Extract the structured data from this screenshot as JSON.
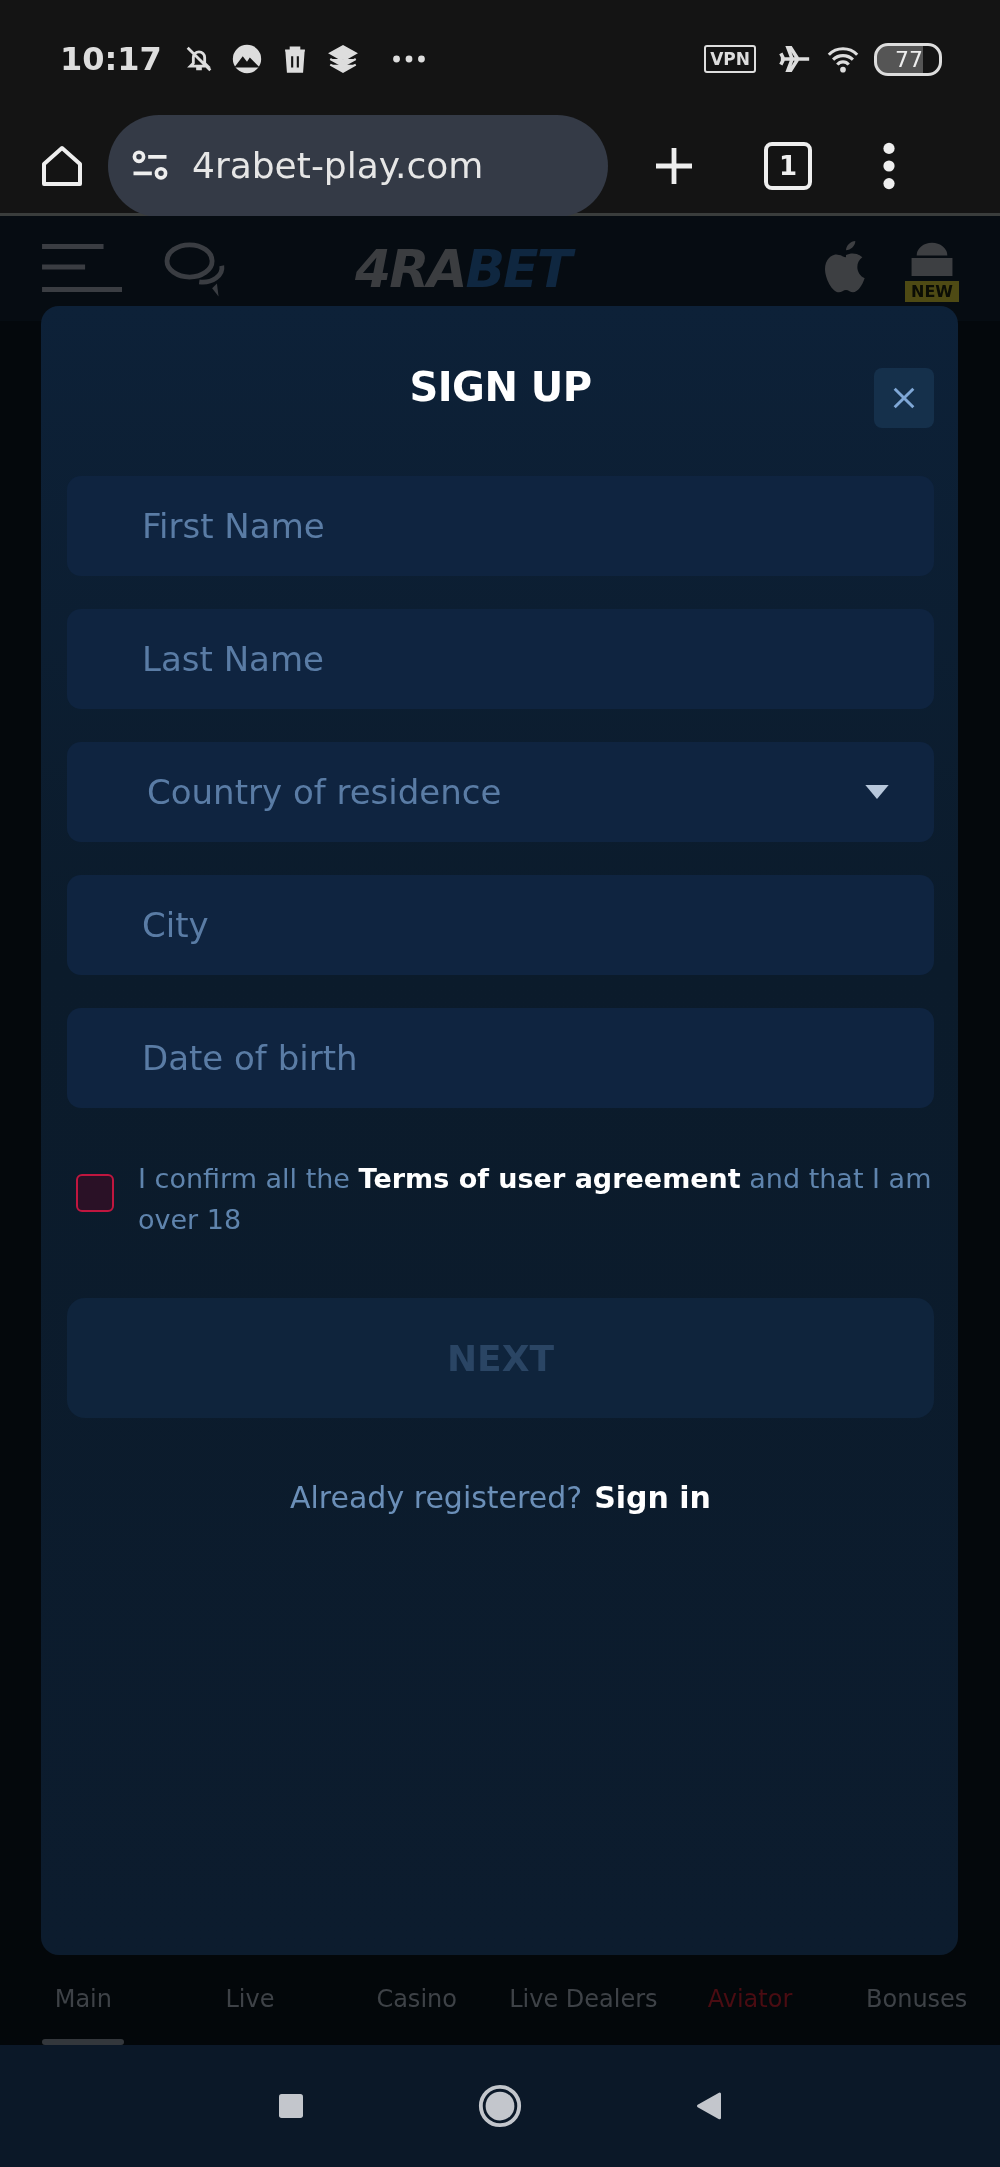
{
  "status_bar": {
    "time": "10:17",
    "vpn": "VPN",
    "battery": "77"
  },
  "browser": {
    "url": "4rabet-play.com",
    "tab_count": "1"
  },
  "site_header": {
    "logo_parts": [
      "4RA",
      "BET"
    ],
    "android_badge": "NEW"
  },
  "modal": {
    "title": "SIGN UP",
    "fields": [
      {
        "kind": "text",
        "placeholder": "First Name"
      },
      {
        "kind": "text",
        "placeholder": "Last Name"
      },
      {
        "kind": "select",
        "placeholder": "Country of residence"
      },
      {
        "kind": "text",
        "placeholder": "City"
      },
      {
        "kind": "text",
        "placeholder": "Date of birth"
      }
    ],
    "agreement": {
      "checked": false,
      "text": "I confirm all the **Terms of user agreement** and that I am over 18"
    },
    "next_button": {
      "label": "NEXT",
      "disabled": true
    },
    "signin": {
      "prompt": "Already registered?",
      "link": "Sign in"
    }
  },
  "bottom_nav": [
    {
      "label": "Main",
      "selected": true,
      "kind": "normal"
    },
    {
      "label": "Live",
      "selected": false,
      "kind": "normal"
    },
    {
      "label": "Casino",
      "selected": false,
      "kind": "normal"
    },
    {
      "label": "Live Dealers",
      "selected": false,
      "kind": "normal"
    },
    {
      "label": "Aviator",
      "selected": false,
      "kind": "promo"
    },
    {
      "label": "Bonuses",
      "selected": false,
      "kind": "normal"
    }
  ]
}
